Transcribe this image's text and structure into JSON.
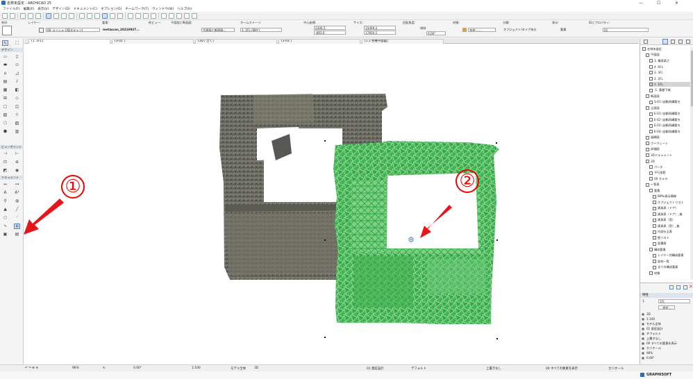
{
  "app": {
    "title": "名称未設定 - ARCHICAD 25"
  },
  "window_controls": [
    "—",
    "☐",
    "✕"
  ],
  "menu": [
    "ファイル(F)",
    "編集(E)",
    "表示(V)",
    "デザイン(D)",
    "ドキュメント(C)",
    "オプション(O)",
    "チームワーク(T)",
    "ウィンドウ(W)",
    "ヘルプ(H)"
  ],
  "infobox": {
    "layer_label": "レイヤー:",
    "layer_value": "00_メッシュ (3Dスキャン)",
    "mesh_label": "要素:",
    "mesh_value": "metascan_20210927...",
    "floor_label": "平面図と断面図:",
    "floor_value": "平面図と断面図...",
    "home_label": "ホームストーリ:",
    "home_value": "1. 1FL [現在]",
    "xy_label": "中心座標:",
    "x_value": "2306.5",
    "y_value": "-893.6",
    "size_label": "サイズ:",
    "w_value": "15469.2",
    "h_value": "17854.1",
    "angle_label": "回転角度:",
    "angle_value": "0.00°",
    "angle_mode": "傾斜",
    "material_label": "材質:",
    "material_value": "木材 - ...",
    "classification_label": "分類:",
    "classification_value": "オブジェクト/タイプ未分",
    "display_label": "表示:",
    "display_value": "要素",
    "id_label": "IDとプロパティ:",
    "id_value": "01",
    "teikeiji_label": "他ビュー:"
  },
  "toolbox": {
    "select_label": "矢印",
    "design_header": "デザイン",
    "viewpoint_header": "ビューポイント",
    "document_header": "ドキュメント"
  },
  "tabs": [
    {
      "label": "[1. 1FL]"
    },
    {
      "label": "[3-01 ]"
    },
    {
      "label": "[3D / 全て]"
    },
    {
      "label": "[3-03 ]"
    },
    {
      "label": "[1.3 各種平面図]"
    }
  ],
  "navigator": {
    "items": [
      {
        "label": "名称未設定",
        "indent": 0,
        "sel": false
      },
      {
        "label": "平面図",
        "indent": 1,
        "sel": false
      },
      {
        "label": "3. 最高高さ",
        "indent": 2,
        "sel": false
      },
      {
        "label": "4. RFL",
        "indent": 2,
        "sel": false
      },
      {
        "label": "3. 3FL",
        "indent": 2,
        "sel": false
      },
      {
        "label": "2. 2FL",
        "indent": 2,
        "sel": false
      },
      {
        "label": "1. 1FL",
        "indent": 2,
        "sel": true
      },
      {
        "label": "-1. 基礎下端",
        "indent": 2,
        "sel": false
      },
      {
        "label": "断面図",
        "indent": 1,
        "sel": false
      },
      {
        "label": "S-01 (自動再構築モ",
        "indent": 2,
        "sel": false
      },
      {
        "label": "立面図",
        "indent": 1,
        "sel": false
      },
      {
        "label": "E-01 (自動再構築モ",
        "indent": 2,
        "sel": false
      },
      {
        "label": "E-02 (自動再構築モ",
        "indent": 2,
        "sel": false
      },
      {
        "label": "E-03 (自動再構築モ",
        "indent": 2,
        "sel": false
      },
      {
        "label": "E-04 (自動再構築モ",
        "indent": 2,
        "sel": false
      },
      {
        "label": "展開図",
        "indent": 1,
        "sel": false
      },
      {
        "label": "ワークシート",
        "indent": 1,
        "sel": false
      },
      {
        "label": "詳細図",
        "indent": 1,
        "sel": false
      },
      {
        "label": "3Dドキュメント",
        "indent": 1,
        "sel": false
      },
      {
        "label": "3D",
        "indent": 1,
        "sel": false
      },
      {
        "label": "パース",
        "indent": 2,
        "sel": false
      },
      {
        "label": "平行投影",
        "indent": 2,
        "sel": false
      },
      {
        "label": "00 カメラ",
        "indent": 2,
        "sel": false
      },
      {
        "label": "一覧表",
        "indent": 1,
        "sel": false
      },
      {
        "label": "要素",
        "indent": 2,
        "sel": false
      },
      {
        "label": "BIMx表示情報",
        "indent": 3,
        "sel": false
      },
      {
        "label": "オブジェクトリスト",
        "indent": 3,
        "sel": false
      },
      {
        "label": "建具表（ドア）",
        "indent": 3,
        "sel": false
      },
      {
        "label": "建具表（ドア）_後",
        "indent": 3,
        "sel": false
      },
      {
        "label": "建具表（窓）",
        "indent": 3,
        "sel": false
      },
      {
        "label": "建具表（窓）_後",
        "indent": 3,
        "sel": false
      },
      {
        "label": "内部仕上表",
        "indent": 3,
        "sel": false
      },
      {
        "label": "壁リスト",
        "indent": 3,
        "sel": false
      },
      {
        "label": "面積表",
        "indent": 3,
        "sel": false
      },
      {
        "label": "構成要素",
        "indent": 2,
        "sel": false
      },
      {
        "label": "レイヤー別構成要素",
        "indent": 3,
        "sel": false
      },
      {
        "label": "部材一覧",
        "indent": 3,
        "sel": false
      },
      {
        "label": "全ての構成要素",
        "indent": 3,
        "sel": false
      },
      {
        "label": "材質",
        "indent": 2,
        "sel": false
      }
    ]
  },
  "properties": {
    "header": "特性",
    "story_num": "1.",
    "story_name": "1FL",
    "settings_label": "設定...",
    "rows": [
      {
        "icon": "▦",
        "label": "3D"
      },
      {
        "icon": "▦",
        "label": "1:100"
      },
      {
        "icon": "▦",
        "label": "モデル全体"
      },
      {
        "icon": "▦",
        "label": "01 意匠設計"
      },
      {
        "icon": "▦",
        "label": "デフォルト"
      },
      {
        "icon": "▦",
        "label": "上書きなし"
      },
      {
        "icon": "▦",
        "label": "00 すべての要素を表示"
      },
      {
        "icon": "▦",
        "label": "カリオール"
      },
      {
        "icon": "▦",
        "label": "96%"
      },
      {
        "icon": "▦",
        "label": "0.00°"
      }
    ]
  },
  "statusbar": {
    "zoom": "96%",
    "angle": "0.00°",
    "scale": "1:100",
    "model": "モデル全体",
    "view3d": "3D",
    "design": "01 意匠設計",
    "default": "デフォルト",
    "override": "上書きなし",
    "showall": "00 すべての要素を表示",
    "renovation": "カリオール"
  },
  "bottombar": {
    "brand": "GRAPHISOFT"
  },
  "annotations": {
    "callout1": "①",
    "callout2": "②",
    "arrow_color": "#e8141c"
  },
  "colors": {
    "mesh_green": "#35b24a",
    "scan_gray": "#6b6b63",
    "accent": "#2f6db5"
  }
}
